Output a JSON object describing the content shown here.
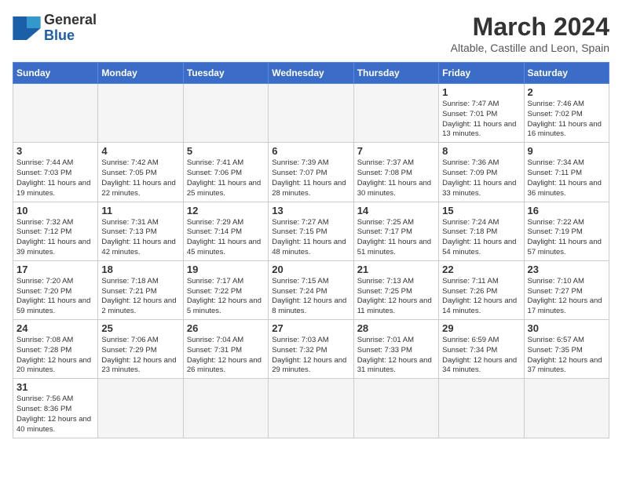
{
  "header": {
    "logo_general": "General",
    "logo_blue": "Blue",
    "month_title": "March 2024",
    "subtitle": "Altable, Castille and Leon, Spain"
  },
  "weekdays": [
    "Sunday",
    "Monday",
    "Tuesday",
    "Wednesday",
    "Thursday",
    "Friday",
    "Saturday"
  ],
  "weeks": [
    [
      {
        "day": "",
        "info": ""
      },
      {
        "day": "",
        "info": ""
      },
      {
        "day": "",
        "info": ""
      },
      {
        "day": "",
        "info": ""
      },
      {
        "day": "",
        "info": ""
      },
      {
        "day": "1",
        "info": "Sunrise: 7:47 AM\nSunset: 7:01 PM\nDaylight: 11 hours and 13 minutes."
      },
      {
        "day": "2",
        "info": "Sunrise: 7:46 AM\nSunset: 7:02 PM\nDaylight: 11 hours and 16 minutes."
      }
    ],
    [
      {
        "day": "3",
        "info": "Sunrise: 7:44 AM\nSunset: 7:03 PM\nDaylight: 11 hours and 19 minutes."
      },
      {
        "day": "4",
        "info": "Sunrise: 7:42 AM\nSunset: 7:05 PM\nDaylight: 11 hours and 22 minutes."
      },
      {
        "day": "5",
        "info": "Sunrise: 7:41 AM\nSunset: 7:06 PM\nDaylight: 11 hours and 25 minutes."
      },
      {
        "day": "6",
        "info": "Sunrise: 7:39 AM\nSunset: 7:07 PM\nDaylight: 11 hours and 28 minutes."
      },
      {
        "day": "7",
        "info": "Sunrise: 7:37 AM\nSunset: 7:08 PM\nDaylight: 11 hours and 30 minutes."
      },
      {
        "day": "8",
        "info": "Sunrise: 7:36 AM\nSunset: 7:09 PM\nDaylight: 11 hours and 33 minutes."
      },
      {
        "day": "9",
        "info": "Sunrise: 7:34 AM\nSunset: 7:11 PM\nDaylight: 11 hours and 36 minutes."
      }
    ],
    [
      {
        "day": "10",
        "info": "Sunrise: 7:32 AM\nSunset: 7:12 PM\nDaylight: 11 hours and 39 minutes."
      },
      {
        "day": "11",
        "info": "Sunrise: 7:31 AM\nSunset: 7:13 PM\nDaylight: 11 hours and 42 minutes."
      },
      {
        "day": "12",
        "info": "Sunrise: 7:29 AM\nSunset: 7:14 PM\nDaylight: 11 hours and 45 minutes."
      },
      {
        "day": "13",
        "info": "Sunrise: 7:27 AM\nSunset: 7:15 PM\nDaylight: 11 hours and 48 minutes."
      },
      {
        "day": "14",
        "info": "Sunrise: 7:25 AM\nSunset: 7:17 PM\nDaylight: 11 hours and 51 minutes."
      },
      {
        "day": "15",
        "info": "Sunrise: 7:24 AM\nSunset: 7:18 PM\nDaylight: 11 hours and 54 minutes."
      },
      {
        "day": "16",
        "info": "Sunrise: 7:22 AM\nSunset: 7:19 PM\nDaylight: 11 hours and 57 minutes."
      }
    ],
    [
      {
        "day": "17",
        "info": "Sunrise: 7:20 AM\nSunset: 7:20 PM\nDaylight: 11 hours and 59 minutes."
      },
      {
        "day": "18",
        "info": "Sunrise: 7:18 AM\nSunset: 7:21 PM\nDaylight: 12 hours and 2 minutes."
      },
      {
        "day": "19",
        "info": "Sunrise: 7:17 AM\nSunset: 7:22 PM\nDaylight: 12 hours and 5 minutes."
      },
      {
        "day": "20",
        "info": "Sunrise: 7:15 AM\nSunset: 7:24 PM\nDaylight: 12 hours and 8 minutes."
      },
      {
        "day": "21",
        "info": "Sunrise: 7:13 AM\nSunset: 7:25 PM\nDaylight: 12 hours and 11 minutes."
      },
      {
        "day": "22",
        "info": "Sunrise: 7:11 AM\nSunset: 7:26 PM\nDaylight: 12 hours and 14 minutes."
      },
      {
        "day": "23",
        "info": "Sunrise: 7:10 AM\nSunset: 7:27 PM\nDaylight: 12 hours and 17 minutes."
      }
    ],
    [
      {
        "day": "24",
        "info": "Sunrise: 7:08 AM\nSunset: 7:28 PM\nDaylight: 12 hours and 20 minutes."
      },
      {
        "day": "25",
        "info": "Sunrise: 7:06 AM\nSunset: 7:29 PM\nDaylight: 12 hours and 23 minutes."
      },
      {
        "day": "26",
        "info": "Sunrise: 7:04 AM\nSunset: 7:31 PM\nDaylight: 12 hours and 26 minutes."
      },
      {
        "day": "27",
        "info": "Sunrise: 7:03 AM\nSunset: 7:32 PM\nDaylight: 12 hours and 29 minutes."
      },
      {
        "day": "28",
        "info": "Sunrise: 7:01 AM\nSunset: 7:33 PM\nDaylight: 12 hours and 31 minutes."
      },
      {
        "day": "29",
        "info": "Sunrise: 6:59 AM\nSunset: 7:34 PM\nDaylight: 12 hours and 34 minutes."
      },
      {
        "day": "30",
        "info": "Sunrise: 6:57 AM\nSunset: 7:35 PM\nDaylight: 12 hours and 37 minutes."
      }
    ],
    [
      {
        "day": "31",
        "info": "Sunrise: 7:56 AM\nSunset: 8:36 PM\nDaylight: 12 hours and 40 minutes."
      },
      {
        "day": "",
        "info": ""
      },
      {
        "day": "",
        "info": ""
      },
      {
        "day": "",
        "info": ""
      },
      {
        "day": "",
        "info": ""
      },
      {
        "day": "",
        "info": ""
      },
      {
        "day": "",
        "info": ""
      }
    ]
  ]
}
